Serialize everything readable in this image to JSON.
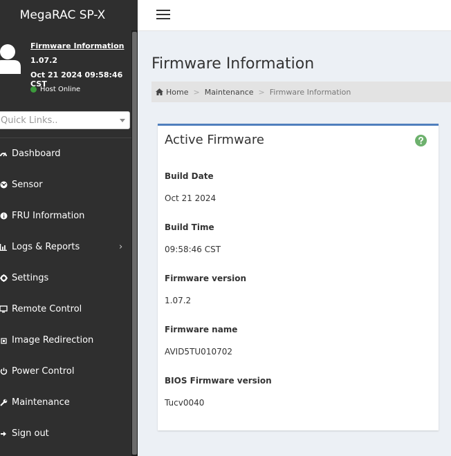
{
  "app": {
    "title": "MegaRAC SP-X"
  },
  "user_panel": {
    "firmware_link": "Firmware Information",
    "version": "1.07.2",
    "datetime": "Oct 21 2024 09:58:46 CST",
    "status": "Host Online",
    "status_color": "#3c9b3c"
  },
  "quick_links": {
    "placeholder": "Quick Links.."
  },
  "nav": {
    "items": [
      {
        "label": "Dashboard",
        "icon": "dashboard-icon"
      },
      {
        "label": "Sensor",
        "icon": "sensor-icon"
      },
      {
        "label": "FRU Information",
        "icon": "fru-icon"
      },
      {
        "label": "Logs & Reports",
        "icon": "bar-chart-icon",
        "has_submenu": true
      },
      {
        "label": "Settings",
        "icon": "gear-icon"
      },
      {
        "label": "Remote Control",
        "icon": "monitor-icon"
      },
      {
        "label": "Image Redirection",
        "icon": "image-redirection-icon"
      },
      {
        "label": "Power Control",
        "icon": "power-icon"
      },
      {
        "label": "Maintenance",
        "icon": "wrench-icon"
      },
      {
        "label": "Sign out",
        "icon": "sign-out-icon"
      }
    ]
  },
  "page": {
    "title": "Firmware Information"
  },
  "breadcrumb": {
    "home": "Home",
    "maintenance": "Maintenance",
    "current": "Firmware Information",
    "separator": ">"
  },
  "firmware_box": {
    "title": "Active Firmware",
    "accent_color": "#4f7fbd",
    "help_icon_color": "#6db16d",
    "fields": [
      {
        "label": "Build Date",
        "value": "Oct 21 2024"
      },
      {
        "label": "Build Time",
        "value": "09:58:46 CST"
      },
      {
        "label": "Firmware version",
        "value": "1.07.2"
      },
      {
        "label": "Firmware name",
        "value": "AVID5TU010702"
      },
      {
        "label": "BIOS Firmware version",
        "value": "Tucv0040"
      }
    ]
  }
}
